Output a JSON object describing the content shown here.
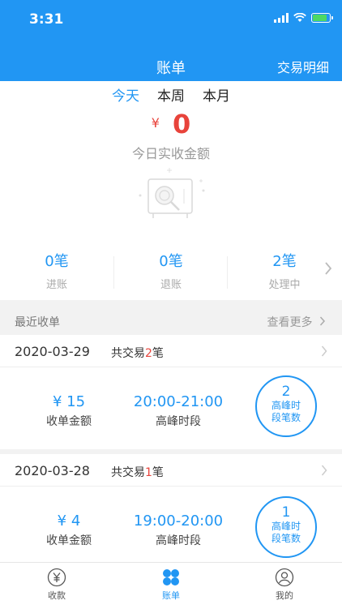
{
  "status": {
    "time": "3:31"
  },
  "nav": {
    "title": "账单",
    "right_action": "交易明细"
  },
  "period_tabs": [
    {
      "label": "今天",
      "active": true
    },
    {
      "label": "本周",
      "active": false
    },
    {
      "label": "本月",
      "active": false
    }
  ],
  "summary": {
    "currency": "¥",
    "amount": "0",
    "amount_label": "今日实收金额"
  },
  "stats": [
    {
      "value": "0笔",
      "label": "进账"
    },
    {
      "value": "0笔",
      "label": "退账"
    },
    {
      "value": "2笔",
      "label": "处理中"
    }
  ],
  "recent": {
    "title": "最近收单",
    "more": "查看更多"
  },
  "records": [
    {
      "date": "2020-03-29",
      "count_prefix": "共交易",
      "count": "2",
      "count_suffix": "笔",
      "amount": "¥ 15",
      "amount_label": "收单金额",
      "peak_time": "20:00-21:00",
      "peak_label": "高峰时段",
      "peak_count": "2",
      "peak_count_label": "高峰时段笔数"
    },
    {
      "date": "2020-03-28",
      "count_prefix": "共交易",
      "count": "1",
      "count_suffix": "笔",
      "amount": "¥ 4",
      "amount_label": "收单金额",
      "peak_time": "19:00-20:00",
      "peak_label": "高峰时段",
      "peak_count": "1",
      "peak_count_label": "高峰时段笔数"
    }
  ],
  "tabbar": [
    {
      "label": "收款",
      "icon": "yen-circle-icon",
      "active": false
    },
    {
      "label": "账单",
      "icon": "grid-icon",
      "active": true
    },
    {
      "label": "我的",
      "icon": "user-icon",
      "active": false
    }
  ],
  "colors": {
    "primary": "#2196f3",
    "accent_red": "#e8433b",
    "background": "#f2f2f2"
  }
}
